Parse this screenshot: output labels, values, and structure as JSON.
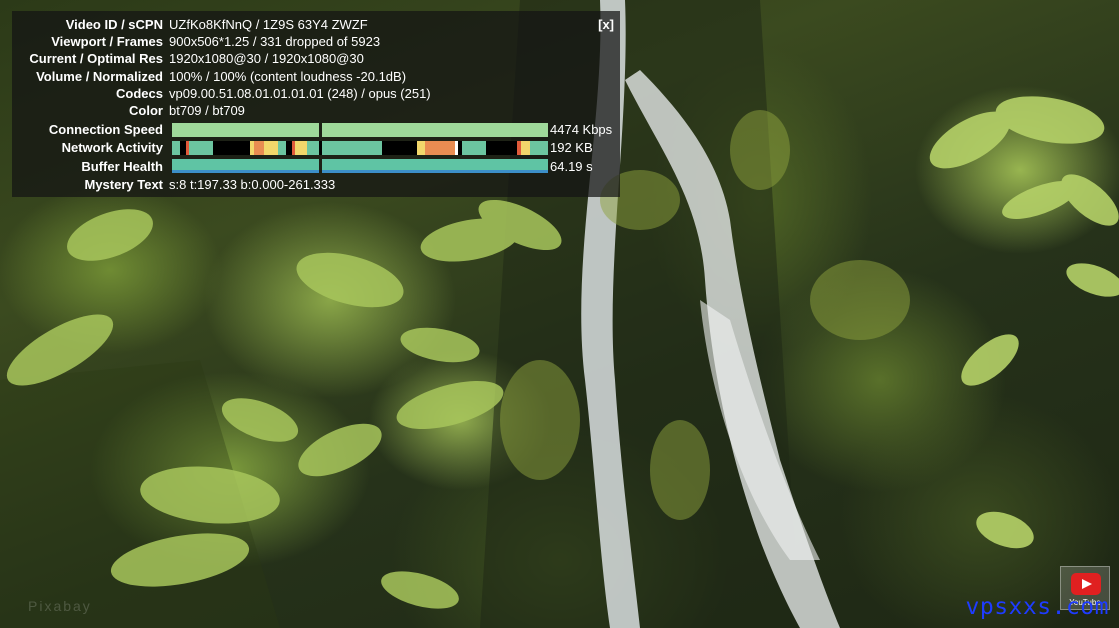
{
  "stats": {
    "close_label": "[x]",
    "rows": [
      {
        "label": "Video ID / sCPN",
        "value": "UZfKo8KfNnQ  /  1Z9S 63Y4 ZWZF"
      },
      {
        "label": "Viewport / Frames",
        "value": "900x506*1.25 / 331 dropped of 5923"
      },
      {
        "label": "Current / Optimal Res",
        "value": "1920x1080@30 / 1920x1080@30"
      },
      {
        "label": "Volume / Normalized",
        "value": "100% / 100% (content loudness -20.1dB)"
      },
      {
        "label": "Codecs",
        "value": "vp09.00.51.08.01.01.01.01 (248) / opus (251)"
      },
      {
        "label": "Color",
        "value": "bt709 / bt709"
      }
    ],
    "connection_speed": {
      "label": "Connection Speed",
      "value": "4474 Kbps"
    },
    "network_activity": {
      "label": "Network Activity",
      "value": "192 KB"
    },
    "buffer_health": {
      "label": "Buffer Health",
      "value": "64.19 s"
    },
    "mystery_text": {
      "label": "Mystery Text",
      "value": "s:8 t:197.33 b:0.000-261.333"
    }
  },
  "logo": {
    "text": "YouTube"
  },
  "watermark": {
    "text": "vpsxxs.com"
  },
  "faint_watermark": {
    "text": "Pixabay"
  },
  "colors": {
    "connection_bar": "#9fd99a",
    "network_bar": "#6cc5a0",
    "buffer_bar": "#5fc4a4",
    "watermark": "#1e3cff"
  }
}
